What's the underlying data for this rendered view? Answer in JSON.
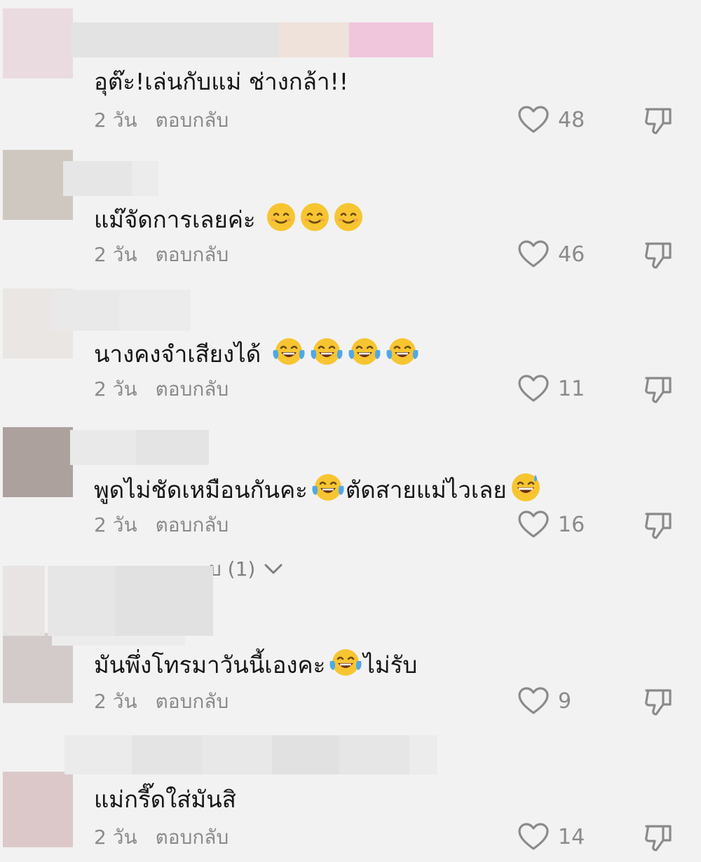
{
  "comments": [
    {
      "text": "อุต๊ะ!เล่นกับแม่ ช่างกล้า!!",
      "emojis": [],
      "time": "2 วัน",
      "reply_label": "ตอบกลับ",
      "likes": "48"
    },
    {
      "text": "แม๊จัดการเลยค่ะ",
      "emojis": [
        "smile-emoji",
        "smile-emoji",
        "smile-emoji"
      ],
      "time": "2 วัน",
      "reply_label": "ตอบกลับ",
      "likes": "46"
    },
    {
      "text": "นางคงจำเสียงได้",
      "emojis": [
        "tears-of-joy-emoji",
        "tears-of-joy-emoji",
        "tears-of-joy-emoji",
        "tears-of-joy-emoji"
      ],
      "time": "2 วัน",
      "reply_label": "ตอบกลับ",
      "likes": "11"
    },
    {
      "text_part1": "พูดไม่ชัดเหมือนกันคะ",
      "text_part2": "ตัดสายแม่ไวเลย",
      "time": "2 วัน",
      "reply_label": "ตอบกลับ",
      "likes": "16"
    },
    {
      "text_part1": "มันพึ่งโทรมาวันนี้เองคะ",
      "text_part2": "ไม่รับ",
      "time": "2 วัน",
      "reply_label": "ตอบกลับ",
      "likes": "9"
    },
    {
      "text": "แม่กรี๊ดใส่มันสิ",
      "time": "2 วัน",
      "reply_label": "ตอบกลับ",
      "likes": "14"
    }
  ],
  "view_replies": {
    "label": "บ (1)"
  },
  "icons": {
    "like": "heart-outline-icon",
    "dislike": "thumbs-down-outline-icon",
    "expand": "chevron-down-icon"
  },
  "colors": {
    "background": "#f2f2f2",
    "text": "#161616",
    "meta": "#8a8a8a",
    "emoji_face": "#f7c531"
  }
}
